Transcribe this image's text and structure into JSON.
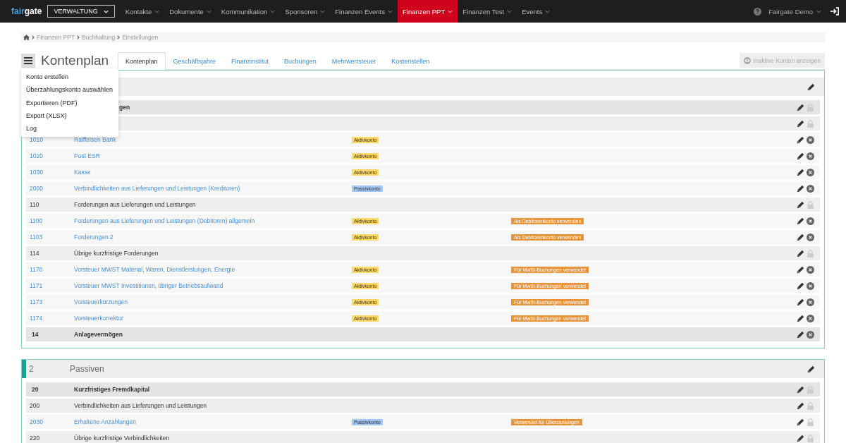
{
  "topbar": {
    "logo": {
      "part1": "fair",
      "part2": "gate"
    },
    "module": "VERWALTUNG",
    "nav": [
      {
        "label": "Kontakte",
        "selected": false
      },
      {
        "label": "Dokumente",
        "selected": false
      },
      {
        "label": "Kommunikation",
        "selected": false
      },
      {
        "label": "Sponsoren",
        "selected": false
      },
      {
        "label": "Finanzen Events",
        "selected": false
      },
      {
        "label": "Finanzen PPT",
        "selected": true
      },
      {
        "label": "Finanzen Test",
        "selected": false
      },
      {
        "label": "Events",
        "selected": false
      }
    ],
    "user": "Fairgate Demo"
  },
  "breadcrumb": [
    "Finanzen PPT",
    "Buchhaltung",
    "Einstellungen"
  ],
  "page_title": "Kontenplan",
  "menu": [
    "Konto erstellen",
    "Überzahlungskonto auswählen",
    "Exportieren (PDF)",
    "Export (XLSX)",
    "Log"
  ],
  "tabs": [
    {
      "label": "Kontenplan",
      "selected": true
    },
    {
      "label": "Geschäftsjahre",
      "selected": false
    },
    {
      "label": "Finanzinstitut",
      "selected": false
    },
    {
      "label": "Buchungen",
      "selected": false
    },
    {
      "label": "Mehrwertsteuer",
      "selected": false
    },
    {
      "label": "Kostenstellen",
      "selected": false
    }
  ],
  "inactive_button": "Inaktive Konten anzeigen",
  "sections": [
    {
      "marked": false,
      "rows": [
        {
          "kind": "group",
          "name": "gen",
          "covered": true,
          "locked": true
        },
        {
          "kind": "subgroup",
          "locked": true
        },
        {
          "kind": "account",
          "number": "1010",
          "name": "Raiffeisen Bank",
          "type_tag": {
            "label": "Aktivkonto",
            "color": "#ffd966"
          },
          "locked": false
        },
        {
          "kind": "account",
          "number": "1020",
          "name": "Post ESR",
          "type_tag": {
            "label": "Aktivkonto",
            "color": "#ffd966"
          },
          "locked": false
        },
        {
          "kind": "account",
          "number": "1030",
          "name": "Kasse",
          "type_tag": {
            "label": "Aktivkonto",
            "color": "#ffd966"
          },
          "locked": false
        },
        {
          "kind": "account",
          "number": "2000",
          "name": "Verbindlichkeiten aus Lieferungen und Leistungen (Kreditoren)",
          "type_tag": {
            "label": "Passivkonto",
            "color": "#a4c8f5"
          },
          "locked": false
        },
        {
          "kind": "subgroup",
          "number": "110",
          "name": "Forderungen aus Lieferungen und Leistungen",
          "locked": true
        },
        {
          "kind": "account",
          "number": "1100",
          "name": "Forderungen aus Lieferungen und Leistungen (Debitoren) allgemein",
          "type_tag": {
            "label": "Aktivkonto",
            "color": "#ffd966"
          },
          "flag": "Als Debitorenkonto verwenden",
          "locked": false
        },
        {
          "kind": "account",
          "number": "1103",
          "name": "Forderungen 2",
          "type_tag": {
            "label": "Aktivkonto",
            "color": "#ffd966"
          },
          "flag": "Als Debitorenkonto verwenden",
          "locked": false
        },
        {
          "kind": "subgroup",
          "number": "114",
          "name": "Übrige kurzfristige Forderungen",
          "locked": true
        },
        {
          "kind": "account",
          "number": "1170",
          "name": "Vorsteuer MWST Material, Waren, Dienstleistungen, Energie",
          "type_tag": {
            "label": "Aktivkonto",
            "color": "#ffd966"
          },
          "flag": "Für MwSt-Buchungen verwendet",
          "locked": false
        },
        {
          "kind": "account",
          "number": "1171",
          "name": "Vorsteuer MWST Investitionen, übriger Betriebsaufwand",
          "type_tag": {
            "label": "Aktivkonto",
            "color": "#ffd966"
          },
          "flag": "Für MwSt-Buchungen verwendet",
          "locked": false
        },
        {
          "kind": "account",
          "number": "1173",
          "name": "Vorsteuerkürzungen",
          "type_tag": {
            "label": "Aktivkonto",
            "color": "#ffd966"
          },
          "flag": "Für MwSt-Buchungen verwendet",
          "locked": false
        },
        {
          "kind": "account",
          "number": "1174",
          "name": "Vorsteuerkorrektur",
          "type_tag": {
            "label": "Aktivkonto",
            "color": "#ffd966"
          },
          "flag": "Für MwSt-Buchungen verwendet",
          "locked": false
        },
        {
          "kind": "group",
          "number": "14",
          "name": "Anlagevermögen",
          "locked": false
        }
      ]
    },
    {
      "marked": true,
      "number": "2",
      "name": "Passiven",
      "rows": [
        {
          "kind": "group",
          "number": "20",
          "name": "Kurzfristiges Fremdkapital",
          "locked": true
        },
        {
          "kind": "subgroup",
          "number": "200",
          "name": "Verbindlichkeiten aus Lieferungen und Leistungen",
          "locked": true
        },
        {
          "kind": "account",
          "number": "2030",
          "name": "Erhaltene Anzahlungen",
          "type_tag": {
            "label": "Passivkonto",
            "color": "#a4c8f5"
          },
          "flag": "Verwendet für Überzahlungen",
          "locked": true
        },
        {
          "kind": "subgroup",
          "number": "220",
          "name": "Übrige kurzfristige Verbindlichkeiten",
          "locked": true
        }
      ]
    }
  ]
}
